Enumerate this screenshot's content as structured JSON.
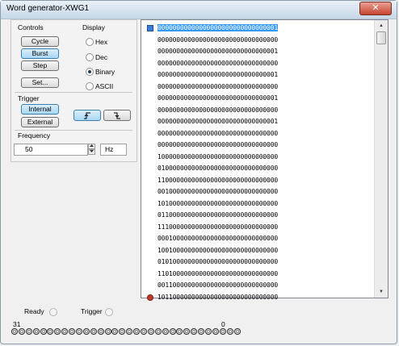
{
  "window": {
    "title": "Word generator-XWG1",
    "close_glyph": "✕"
  },
  "controls": {
    "label": "Controls",
    "cycle": "Cycle",
    "burst": "Burst",
    "step": "Step",
    "set": "Set..."
  },
  "display": {
    "label": "Display",
    "options": [
      "Hex",
      "Dec",
      "Binary",
      "ASCII"
    ],
    "selected": "Binary"
  },
  "trigger": {
    "label": "Trigger",
    "internal": "Internal",
    "external": "External",
    "rising_icon": "rising-edge-icon",
    "falling_icon": "falling-edge-icon"
  },
  "frequency": {
    "label": "Frequency",
    "value": "50",
    "unit": "Hz"
  },
  "words": [
    "00000000000000000000000000000001",
    "00000000000000000000000000000000",
    "00000000000000000000000000000001",
    "00000000000000000000000000000000",
    "00000000000000000000000000000001",
    "00000000000000000000000000000000",
    "00000000000000000000000000000001",
    "00000000000000000000000000000000",
    "00000000000000000000000000000001",
    "00000000000000000000000000000000",
    "00000000000000000000000000000000",
    "10000000000000000000000000000000",
    "01000000000000000000000000000000",
    "11000000000000000000000000000000",
    "00100000000000000000000000000000",
    "10100000000000000000000000000000",
    "01100000000000000000000000000000",
    "11100000000000000000000000000000",
    "00010000000000000000000000000000",
    "10010000000000000000000000000000",
    "01010000000000000000000000000000",
    "11010000000000000000000000000000",
    "00110000000000000000000000000000",
    "10110000000000000000000000000000"
  ],
  "status": {
    "ready": "Ready",
    "trigger": "Trigger"
  },
  "bit_range": {
    "high": "31",
    "low": "0"
  },
  "colors": {
    "selection": "#3399ff",
    "active_button": "#a9d7f6"
  }
}
